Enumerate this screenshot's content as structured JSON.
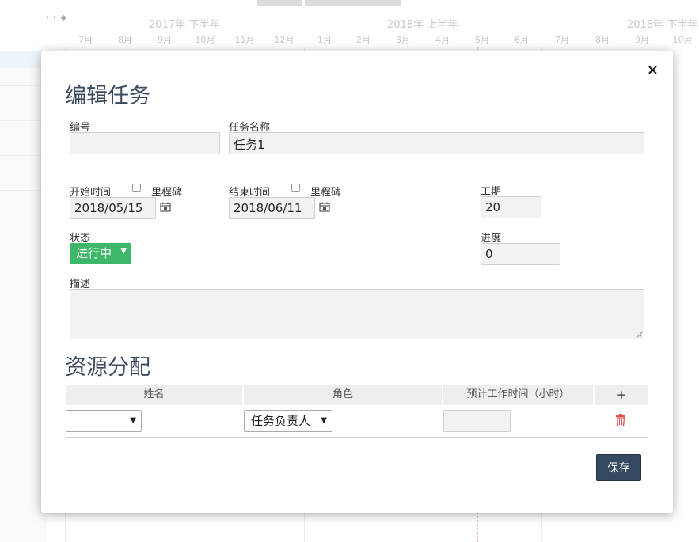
{
  "gantt": {
    "nav_icons": "‹ › ◆",
    "periods": [
      "2017年-下半年",
      "2018年-上半年",
      "2018年-下半年"
    ],
    "months": [
      "7月",
      "8月",
      "9月",
      "10月",
      "11月",
      "12月",
      "1月",
      "2月",
      "3月",
      "4月",
      "5月",
      "6月",
      "7月",
      "8月",
      "9月",
      "10月"
    ]
  },
  "modal": {
    "close": "×",
    "title": "编辑任务",
    "code_label": "编号",
    "code_value": "",
    "name_label": "任务名称",
    "name_value": "任务1",
    "start_label": "开始时间",
    "start_milestone": "里程碑",
    "start_value": "2018/05/15",
    "end_label": "结束时间",
    "end_milestone": "里程碑",
    "end_value": "2018/06/11",
    "duration_label": "工期",
    "duration_value": "20",
    "status_label": "状态",
    "status_value": "进行中",
    "progress_label": "进度",
    "progress_value": "0",
    "desc_label": "描述",
    "resources_title": "资源分配",
    "table_headers": [
      "姓名",
      "角色",
      "预计工作时间（小时）",
      "+"
    ],
    "resource_row": {
      "name_value": "",
      "role_value": "任务负责人",
      "hours_value": ""
    },
    "save_label": "保存"
  },
  "colors": {
    "status_green": "#3db86a",
    "save_button": "#354961",
    "heading": "#3c4a5e",
    "trash_red": "#e05050"
  }
}
